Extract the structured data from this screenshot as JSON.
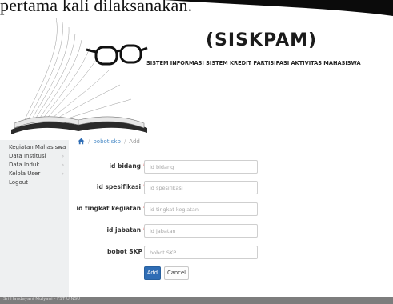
{
  "caption": "pertama kali dilaksanakan.",
  "header": {
    "title": "(SISKPAM)",
    "subtitle": "SISTEM INFORMASI SISTEM KREDIT PARTISIPASI AKTIVITAS MAHASISWA"
  },
  "sidebar": {
    "items": [
      {
        "label": "Kegiatan Mahasiswa",
        "has_submenu": false
      },
      {
        "label": "Data Institusi",
        "has_submenu": true
      },
      {
        "label": "Data Induk",
        "has_submenu": true
      },
      {
        "label": "Kelola User",
        "has_submenu": true
      },
      {
        "label": "Logout",
        "has_submenu": false
      }
    ],
    "arrow_glyph": "›"
  },
  "breadcrumb": {
    "icon": "home-icon",
    "items": [
      "bobot skp",
      "Add"
    ],
    "separator": "/"
  },
  "form": {
    "fields": [
      {
        "label": "id bidang",
        "required": true,
        "placeholder": "id bidang",
        "value": ""
      },
      {
        "label": "id spesifikasi",
        "required": true,
        "placeholder": "id spesifikasi",
        "value": ""
      },
      {
        "label": "id tingkat kegiatan",
        "required": true,
        "placeholder": "id tingkat kegiatan",
        "value": ""
      },
      {
        "label": "id jabatan",
        "required": true,
        "placeholder": "id jabatan",
        "value": ""
      },
      {
        "label": "bobot SKP",
        "required": false,
        "placeholder": "bobot SKP",
        "value": ""
      }
    ],
    "required_marker": "*",
    "add_label": "Add",
    "cancel_label": "Cancel"
  },
  "footer": {
    "text": "Sri Handayani Mulyani - FST UINSU"
  },
  "colors": {
    "primary": "#2f6db5",
    "link": "#4a8bc7",
    "required": "#d9534f",
    "sidebar_bg": "#eef0f1",
    "footer_bg": "#7d7d7d"
  }
}
